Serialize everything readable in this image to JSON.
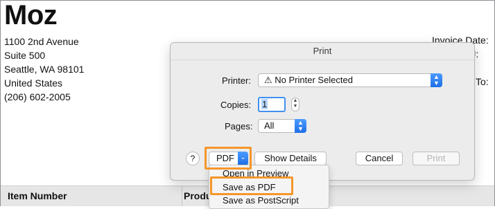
{
  "invoice": {
    "logo": "Moz",
    "address": [
      "1100 2nd Avenue",
      "Suite 500",
      "Seattle, WA 98101",
      "United States",
      "(206) 602-2005"
    ],
    "invoice_date_label": "Invoice Date:",
    "invoice_number_label": "e #:",
    "to_label": "To:",
    "table_headers": [
      "Item Number",
      "Produ"
    ]
  },
  "print_dialog": {
    "title": "Print",
    "printer_label": "Printer:",
    "printer_value": "⚠ No Printer Selected",
    "copies_label": "Copies:",
    "copies_value": "1",
    "pages_label": "Pages:",
    "pages_value": "All",
    "help_label": "?",
    "pdf_label": "PDF",
    "show_details_label": "Show Details",
    "cancel_label": "Cancel",
    "print_label": "Print"
  },
  "pdf_menu": {
    "items": [
      "Open in Preview",
      "Save as PDF",
      "Save as PostScript"
    ],
    "highlighted": "Save as PDF"
  },
  "colors": {
    "highlight": "#f5962a",
    "accent": "#1e6fe6"
  }
}
